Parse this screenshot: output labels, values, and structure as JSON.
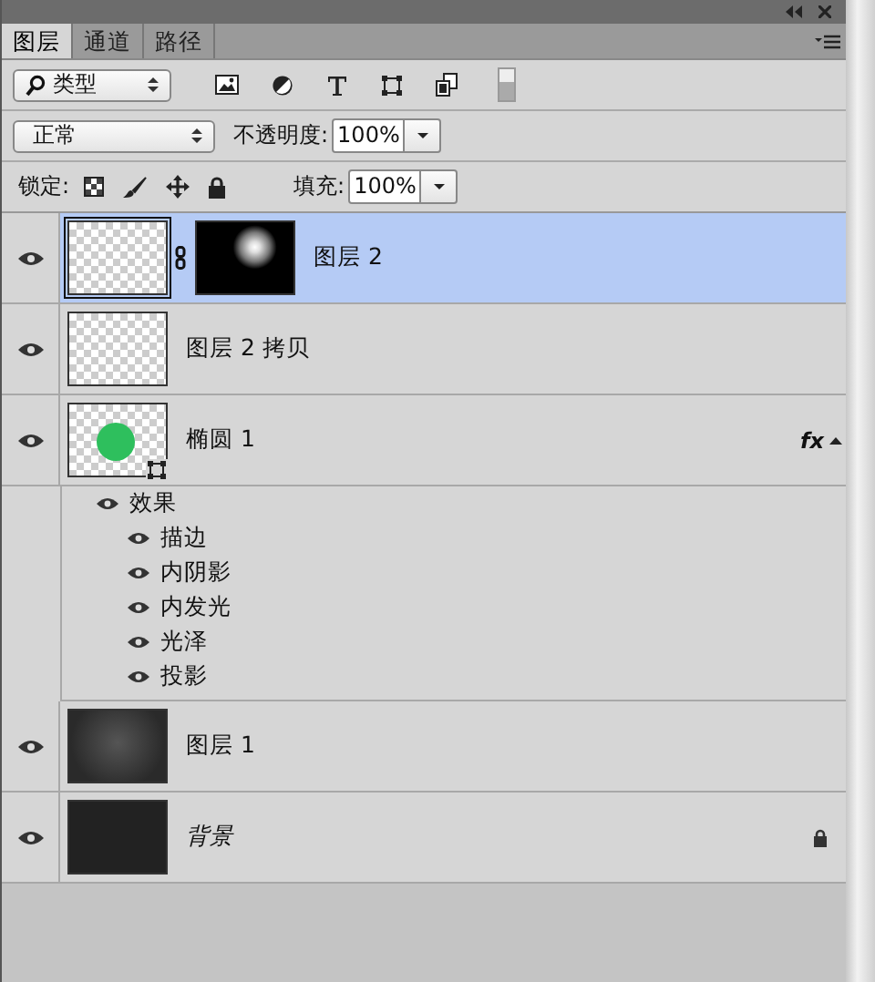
{
  "panel_tabs": [
    {
      "label": "图层",
      "selected": true
    },
    {
      "label": "通道",
      "selected": false
    },
    {
      "label": "路径",
      "selected": false
    }
  ],
  "filter": {
    "value": "类型"
  },
  "blend_mode": {
    "value": "正常"
  },
  "opacity": {
    "label": "不透明度:",
    "value": "100%"
  },
  "lock": {
    "label": "锁定:"
  },
  "fill": {
    "label": "填充:",
    "value": "100%"
  },
  "layers": [
    {
      "name": "图层 2",
      "selected": true,
      "visible": true,
      "kind": "transparent",
      "mask": true
    },
    {
      "name": "图层 2 拷贝",
      "selected": false,
      "visible": true,
      "kind": "transparent"
    },
    {
      "name": "椭圆 1",
      "selected": false,
      "visible": true,
      "kind": "ellipse",
      "fx": "fx",
      "effects_label": "效果",
      "effects_visible": true,
      "effects": [
        {
          "name": "描边",
          "visible": true
        },
        {
          "name": "内阴影",
          "visible": true
        },
        {
          "name": "内发光",
          "visible": true
        },
        {
          "name": "光泽",
          "visible": true
        },
        {
          "name": "投影",
          "visible": true
        }
      ]
    },
    {
      "name": "图层 1",
      "selected": false,
      "visible": true,
      "kind": "glow"
    },
    {
      "name": "背景",
      "selected": false,
      "visible": true,
      "kind": "dark",
      "locked": true
    }
  ]
}
